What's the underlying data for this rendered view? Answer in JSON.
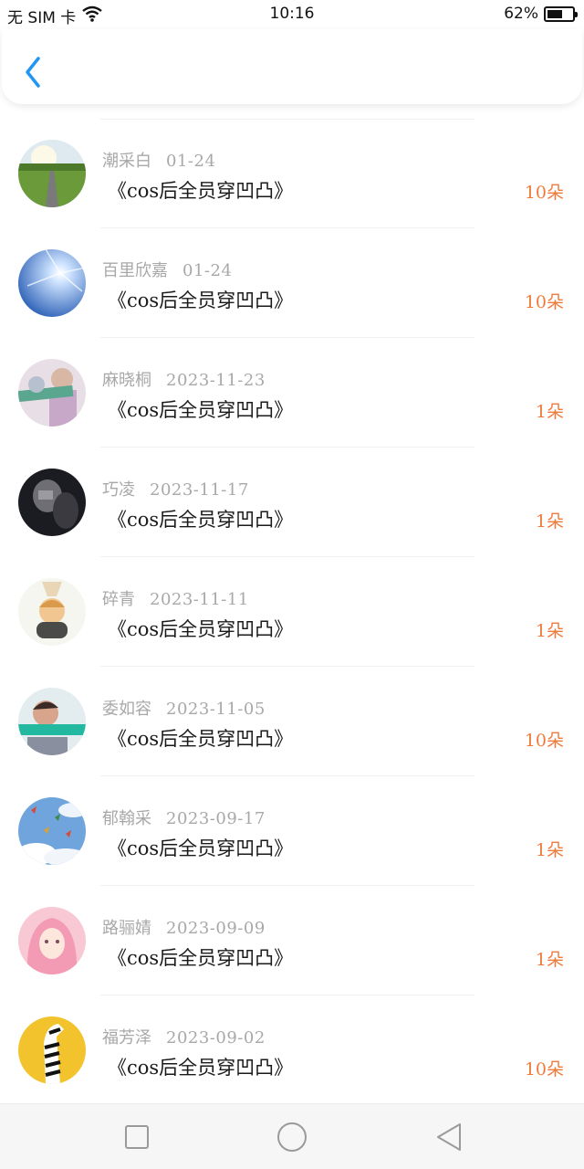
{
  "status": {
    "carrier": "无 SIM 卡",
    "time": "10:16",
    "battery": "62%",
    "battery_level": 0.62
  },
  "header": {
    "back_icon": "chevron-left-icon",
    "accent": "#2196F3"
  },
  "colors": {
    "gift_accent": "#F07A3C",
    "meta_gray": "#A8A8A8"
  },
  "list": {
    "items": [
      {
        "name": "潮采白",
        "date": "01-24",
        "title": "《cos后全员穿凹凸》",
        "gift": "10朵",
        "avatar": "road-landscape"
      },
      {
        "name": "百里欣嘉",
        "date": "01-24",
        "title": "《cos后全员穿凹凸》",
        "gift": "10朵",
        "avatar": "blue-sky-sun"
      },
      {
        "name": "麻晓桐",
        "date": "2023-11-23",
        "title": "《cos后全员穿凹凸》",
        "gift": "1朵",
        "avatar": "couple-photo"
      },
      {
        "name": "巧凌",
        "date": "2023-11-17",
        "title": "《cos后全员穿凹凸》",
        "gift": "1朵",
        "avatar": "dark-portrait"
      },
      {
        "name": "碎青",
        "date": "2023-11-11",
        "title": "《cos后全员穿凹凸》",
        "gift": "1朵",
        "avatar": "cartoon-boy"
      },
      {
        "name": "委如容",
        "date": "2023-11-05",
        "title": "《cos后全员穿凹凸》",
        "gift": "10朵",
        "avatar": "boy-banner"
      },
      {
        "name": "郁翰采",
        "date": "2023-09-17",
        "title": "《cos后全员穿凹凸》",
        "gift": "1朵",
        "avatar": "paper-cranes"
      },
      {
        "name": "路骊婧",
        "date": "2023-09-09",
        "title": "《cos后全员穿凹凸》",
        "gift": "1朵",
        "avatar": "pink-girl"
      },
      {
        "name": "福芳泽",
        "date": "2023-09-02",
        "title": "《cos后全员穿凹凸》",
        "gift": "10朵",
        "avatar": "zebra"
      }
    ]
  },
  "navbar": {
    "recent_icon": "square-icon",
    "home_icon": "circle-icon",
    "back_icon": "triangle-back-icon"
  }
}
